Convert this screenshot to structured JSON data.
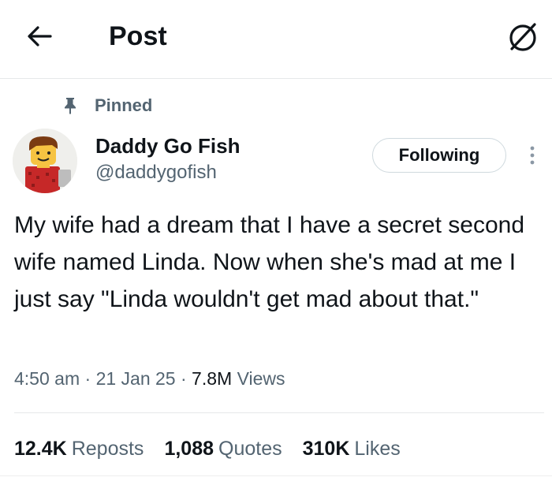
{
  "header": {
    "title": "Post",
    "back_icon": "arrow-left-icon",
    "grok_icon": "grok-slash-circle-icon"
  },
  "pinned": {
    "label": "Pinned",
    "icon": "pin-icon"
  },
  "author": {
    "name": "Daddy Go Fish",
    "handle": "@daddygofish",
    "avatar": "lego-minifigure-avatar"
  },
  "follow_button": {
    "label": "Following"
  },
  "more_icon": "more-vertical-icon",
  "post": {
    "text": "My wife had a dream that I have a secret second wife named Linda. Now when she's mad at me I just say \"Linda wouldn't get mad about that.\""
  },
  "meta": {
    "time": "4:50 am",
    "separator": "·",
    "date": "21 Jan 25",
    "views_count": "7.8M",
    "views_label": "Views"
  },
  "stats": {
    "reposts_count": "12.4K",
    "reposts_label": "Reposts",
    "quotes_count": "1,088",
    "quotes_label": "Quotes",
    "likes_count": "310K",
    "likes_label": "Likes"
  },
  "colors": {
    "text_primary": "#0f1419",
    "text_secondary": "#536471",
    "border": "#cfd9de",
    "divider": "#e6e8ea"
  }
}
